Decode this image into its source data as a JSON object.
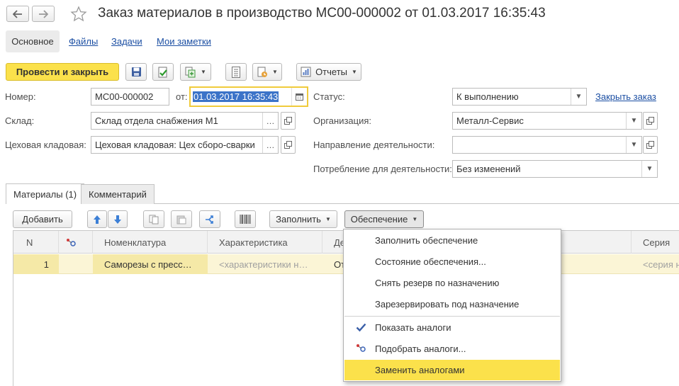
{
  "window": {
    "title": "Заказ материалов в производство МС00-000002 от 01.03.2017 16:35:43"
  },
  "nav_tabs": [
    {
      "label": "Основное"
    },
    {
      "label": "Файлы"
    },
    {
      "label": "Задачи"
    },
    {
      "label": "Мои заметки"
    }
  ],
  "toolbar": {
    "post_close": "Провести и закрыть",
    "reports": "Отчеты"
  },
  "form": {
    "number_label": "Номер:",
    "number_value": "МС00-000002",
    "date_label": "от:",
    "date_value": "01.03.2017 16:35:43",
    "status_label": "Статус:",
    "status_value": "К выполнению",
    "close_order_link": "Закрыть заказ",
    "warehouse_label": "Склад:",
    "warehouse_value": "Склад отдела снабжения М1",
    "organization_label": "Организация:",
    "organization_value": "Металл-Сервис",
    "shop_storeroom_label": "Цеховая кладовая:",
    "shop_storeroom_value": "Цеховая кладовая: Цех сборо-сварки",
    "activity_direction_label": "Направление деятельности:",
    "activity_direction_value": "",
    "consumption_label": "Потребление для деятельности:",
    "consumption_value": "Без изменений"
  },
  "content_tabs": [
    {
      "label": "Материалы (1)"
    },
    {
      "label": "Комментарий"
    }
  ],
  "table_toolbar": {
    "add": "Добавить",
    "fill": "Заполнить",
    "supply": "Обеспечение"
  },
  "table": {
    "columns": [
      "N",
      "",
      "Номенклатура",
      "Характеристика",
      "Де",
      "Серия"
    ],
    "rows": [
      {
        "n": "1",
        "nomenclature": "Саморезы с пресс…",
        "characteristic": "<характеристики н…",
        "action": "От",
        "series": "<серия н"
      }
    ]
  },
  "supply_menu": {
    "items": [
      {
        "label": "Заполнить обеспечение"
      },
      {
        "label": "Состояние обеспечения..."
      },
      {
        "label": "Снять резерв по назначению"
      },
      {
        "label": "Зарезервировать под назначение"
      },
      {
        "label": "Показать аналоги",
        "checked": true
      },
      {
        "label": "Подобрать аналоги...",
        "icon": "analogs-icon"
      },
      {
        "label": "Заменить аналогами",
        "highlighted": true
      }
    ]
  },
  "colors": {
    "accent_yellow": "#fbe14b",
    "selected_row": "#fbf5d6",
    "link_blue": "#1c4fa3",
    "date_selection": "#3b73c8"
  }
}
